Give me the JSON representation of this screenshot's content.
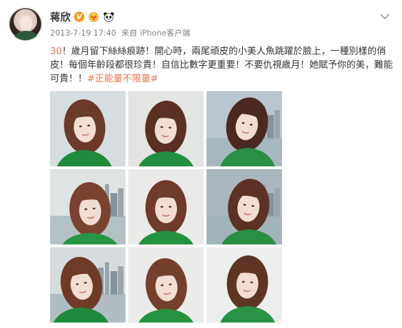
{
  "user": {
    "name": "蒋欣",
    "verified_badge": "V",
    "badges": [
      "verified-v-icon",
      "crown-icon",
      "panda-icon"
    ]
  },
  "meta": {
    "timestamp": "2013-7-19 17:40",
    "source_prefix": "来自",
    "device": "iPhone客户端"
  },
  "post": {
    "lead": "30",
    "body": "！歲月留下絲絲痕跡！開心時，兩尾頑皮的小美人魚跳躍於臉上，一種別樣的俏皮！每個年齡段都很珍貴！自信比數字更重要！不要仇視歲月！她賦予你的美，難能可貴！！",
    "hashtag": "#正能量不限量#"
  },
  "photos": [
    {
      "label": "photo-1",
      "bg": "#c9d2d6",
      "hair": "#6b3a2a",
      "top": "#1f8a3b"
    },
    {
      "label": "photo-2",
      "bg": "#d8dcd8",
      "hair": "#5a3022",
      "top": "#238e3f"
    },
    {
      "label": "photo-3",
      "bg": "#b9c6cf",
      "hair": "#4a2a20",
      "top": "#2a8f44"
    },
    {
      "label": "photo-4",
      "bg": "#dfe3e2",
      "hair": "#7a4330",
      "top": "#289545"
    },
    {
      "label": "photo-5",
      "bg": "#e3e4e2",
      "hair": "#6e3b2c",
      "top": "#24913f"
    },
    {
      "label": "photo-6",
      "bg": "#aab7bf",
      "hair": "#5c3126",
      "top": "#2b8e45"
    },
    {
      "label": "photo-7",
      "bg": "#d6dcdd",
      "hair": "#6f3a28",
      "top": "#1f8a3b"
    },
    {
      "label": "photo-8",
      "bg": "#e4e5e3",
      "hair": "#74402d",
      "top": "#26923f"
    },
    {
      "label": "photo-9",
      "bg": "#e7e8e8",
      "hair": "#5f3424",
      "top": "#2a9244"
    }
  ],
  "colors": {
    "accent": "#eb7350",
    "text": "#333333",
    "meta": "#808080"
  }
}
